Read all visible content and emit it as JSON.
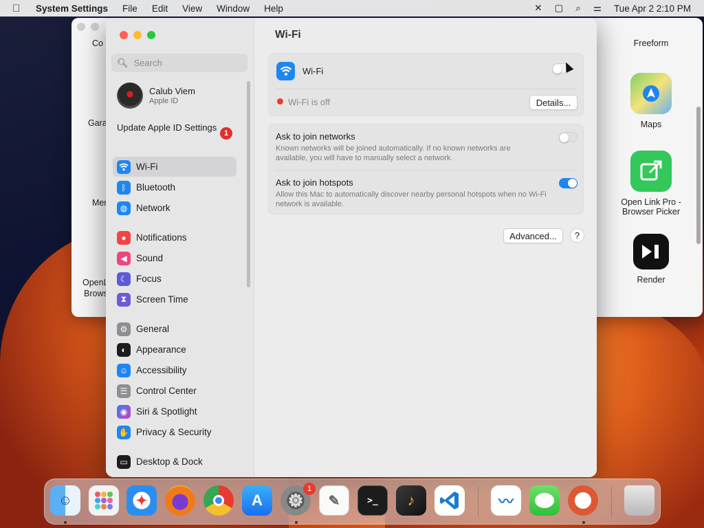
{
  "menubar": {
    "app": "System Settings",
    "items": [
      "File",
      "Edit",
      "View",
      "Window",
      "Help"
    ],
    "clock": "Tue Apr 2  2:10 PM",
    "status_icons": [
      "close-x-icon",
      "window-icon",
      "search-icon",
      "control-center-icon"
    ]
  },
  "background_window": {
    "left_labels": [
      "Co",
      "Gara",
      "Mer",
      "OpenL",
      "Brows"
    ],
    "apps": [
      {
        "name": "Freeform",
        "icon": "freeform-icon"
      },
      {
        "name": "Maps",
        "icon": "maps-icon"
      },
      {
        "name": "Open Link Pro -",
        "name2": "Browser Picker",
        "icon": "open-link-pro-icon"
      },
      {
        "name": "Render",
        "icon": "render-icon"
      }
    ]
  },
  "sidebar": {
    "search_placeholder": "Search",
    "user_name": "Calub Viem",
    "user_sub": "Apple ID",
    "update_text": "Update Apple ID Settings",
    "update_badge": "1",
    "items": [
      {
        "label": "Wi-Fi",
        "icon": "wifi-icon",
        "color": "#1f86f0",
        "selected": true
      },
      {
        "label": "Bluetooth",
        "icon": "bluetooth-icon",
        "color": "#1f86f0"
      },
      {
        "label": "Network",
        "icon": "globe-icon",
        "color": "#1f86f0"
      },
      {
        "label": "Notifications",
        "icon": "bell-icon",
        "color": "#f04545"
      },
      {
        "label": "Sound",
        "icon": "speaker-icon",
        "color": "#f0457a"
      },
      {
        "label": "Focus",
        "icon": "moon-icon",
        "color": "#5e5ad6"
      },
      {
        "label": "Screen Time",
        "icon": "hourglass-icon",
        "color": "#6d5ad6"
      },
      {
        "label": "General",
        "icon": "gear-icon",
        "color": "#8e8e93"
      },
      {
        "label": "Appearance",
        "icon": "appearance-icon",
        "color": "#1c1c1e"
      },
      {
        "label": "Accessibility",
        "icon": "accessibility-icon",
        "color": "#1f86f0"
      },
      {
        "label": "Control Center",
        "icon": "toggles-icon",
        "color": "#8e8e93"
      },
      {
        "label": "Siri & Spotlight",
        "icon": "siri-icon",
        "color": "#b040d0"
      },
      {
        "label": "Privacy & Security",
        "icon": "hand-icon",
        "color": "#1f86f0"
      },
      {
        "label": "Desktop & Dock",
        "icon": "dock-icon",
        "color": "#1c1c1e"
      }
    ]
  },
  "content": {
    "title": "Wi-Fi",
    "wifi_label": "Wi-Fi",
    "wifi_on": false,
    "status_text": "Wi-Fi is off",
    "status_color": "#e83a30",
    "details_button": "Details...",
    "ask_networks_title": "Ask to join networks",
    "ask_networks_desc": "Known networks will be joined automatically. If no known networks are available, you will have to manually select a network.",
    "ask_networks_on": false,
    "ask_hotspots_title": "Ask to join hotspots",
    "ask_hotspots_desc": "Allow this Mac to automatically discover nearby personal hotspots when no Wi-Fi network is available.",
    "ask_hotspots_on": true,
    "advanced_button": "Advanced...",
    "help_button": "?",
    "accent": "#1f86f0"
  },
  "dock": {
    "settings_badge": "1",
    "apps": [
      "finder-icon",
      "launchpad-icon",
      "safari-icon",
      "firefox-icon",
      "chrome-icon",
      "app-store-icon",
      "system-settings-icon",
      "textedit-icon",
      "terminal-icon",
      "garageband-icon",
      "vscode-icon",
      "freeform-icon",
      "messages-icon",
      "duckduckgo-icon",
      "trash-icon"
    ]
  }
}
